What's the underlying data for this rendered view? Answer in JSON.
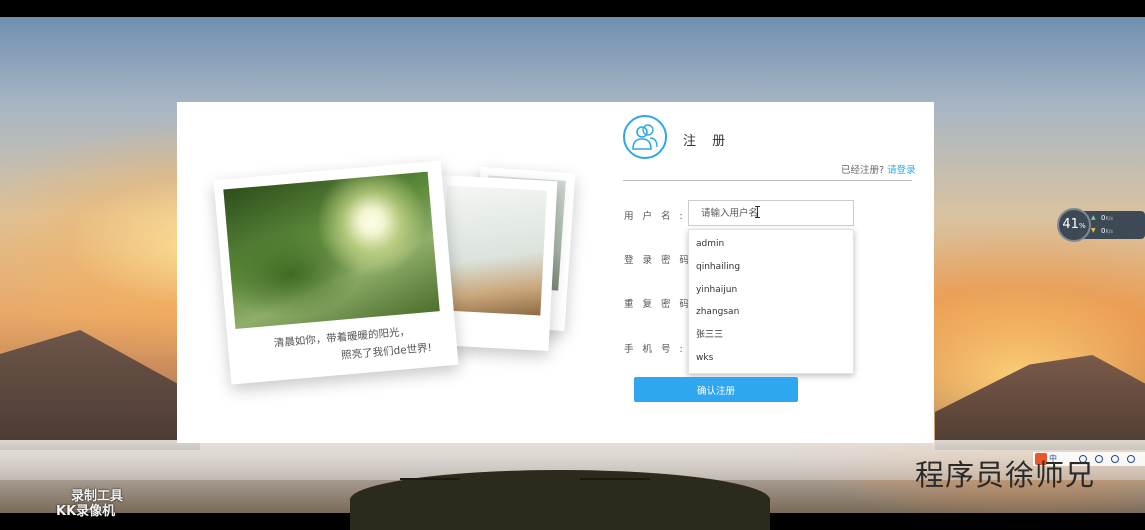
{
  "register": {
    "title": "注 册",
    "already_text": "已经注册?",
    "login_link": "请登录",
    "submit_label": "确认注册",
    "fields": {
      "username": {
        "label": "用 户 名 :",
        "placeholder": "请输入用户名"
      },
      "password": {
        "label": "登 录 密 码 :"
      },
      "password_repeat": {
        "label": "重 复 密 码 :"
      },
      "phone": {
        "label": "手 机 号 :"
      }
    },
    "autocomplete": [
      "admin",
      "qinhailing",
      "yinhaijun",
      "zhangsan",
      "张三三",
      "wks"
    ]
  },
  "photo": {
    "caption_line1": "清晨如你，带着暖暖的阳光，",
    "caption_line2": "照亮了我们de世界!"
  },
  "speed_widget": {
    "percent": "41",
    "percent_unit": "%",
    "upload": "0",
    "upload_unit": "K/s",
    "download": "0",
    "download_unit": "K/s"
  },
  "tray": {
    "ime": "中"
  },
  "watermark": {
    "tool_line1": "录制工具",
    "tool_line2": "KK录像机",
    "author": "程序员徐师兄"
  },
  "colors": {
    "accent": "#2ea7e6",
    "button": "#2ea7f0"
  }
}
